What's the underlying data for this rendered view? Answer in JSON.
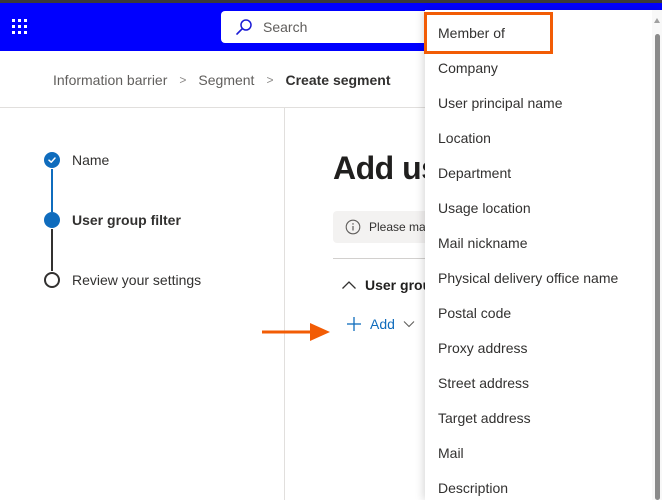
{
  "header": {
    "app_launcher_icon": "waffle-grid-icon",
    "search": {
      "placeholder": "Search",
      "icon": "search-icon"
    },
    "brand_color": "#0000ff"
  },
  "breadcrumb": {
    "items": [
      "Information barrier",
      "Segment",
      "Create segment"
    ],
    "separator_icon": "chevron-right-icon"
  },
  "wizard": {
    "steps": [
      {
        "label": "Name",
        "state": "completed",
        "icon": "checkmark-circle-icon"
      },
      {
        "label": "User group filter",
        "state": "current",
        "icon": "filled-circle-icon"
      },
      {
        "label": "Review your settings",
        "state": "pending",
        "icon": "empty-circle-icon"
      }
    ],
    "accent_color": "#0f6cbd"
  },
  "main": {
    "title": "Add us",
    "info_bar": {
      "icon": "info-icon",
      "text": "Please mak"
    },
    "section": {
      "label": "User grou",
      "icon": "chevron-up-icon"
    },
    "add_button": {
      "label": "Add",
      "icon": "plus-icon",
      "chevron": "chevron-down-icon"
    }
  },
  "dropdown": {
    "items": [
      "Member of",
      "Company",
      "User principal name",
      "Location",
      "Department",
      "Usage location",
      "Mail nickname",
      "Physical delivery office name",
      "Postal code",
      "Proxy address",
      "Street address",
      "Target address",
      "Mail",
      "Description"
    ],
    "highlighted_item": "Member of"
  },
  "annotations": {
    "highlight_color": "#f25c05",
    "arrow_target": "Add"
  }
}
